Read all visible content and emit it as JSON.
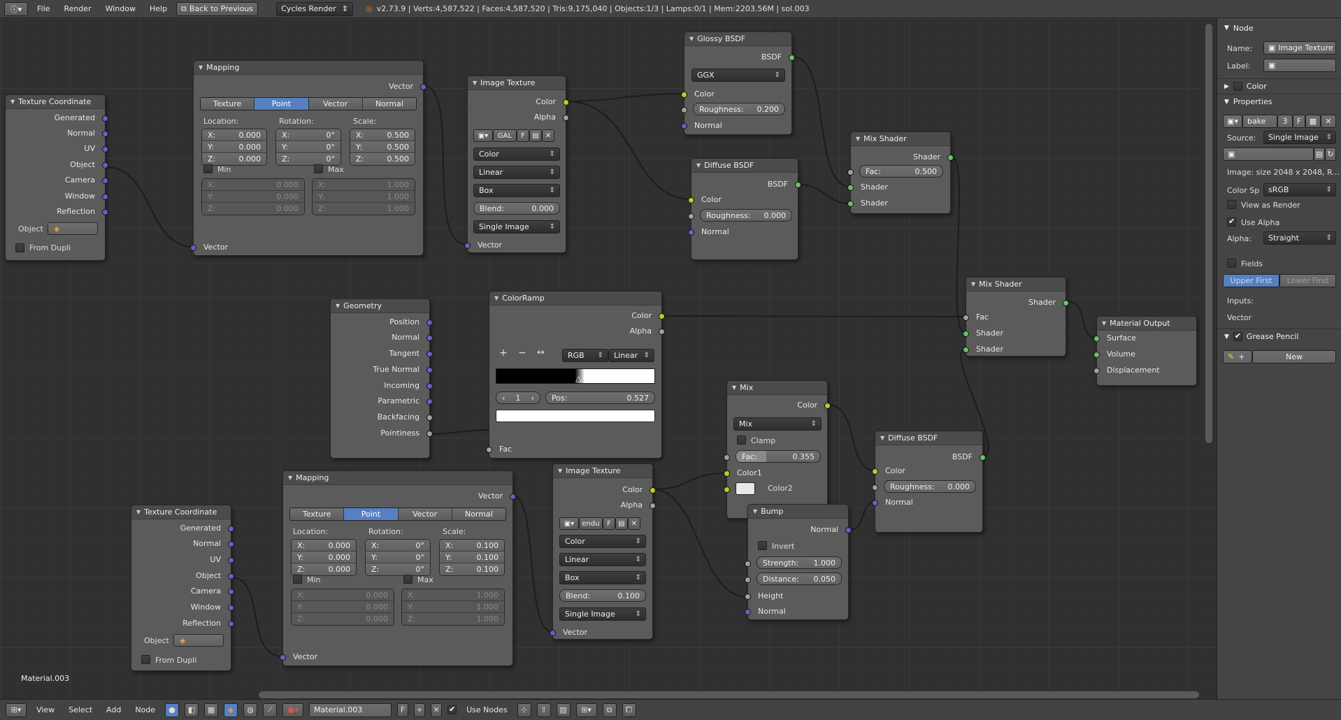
{
  "topbar": {
    "menus": [
      "File",
      "Render",
      "Window",
      "Help"
    ],
    "back_button": "Back to Previous",
    "engine": "Cycles Render",
    "stats": "v2.73.9 | Verts:4,587,522 | Faces:4,587,520 | Tris:9,175,040 | Objects:1/3 | Lamps:0/1 | Mem:2203.56M | sol.003"
  },
  "nodes": {
    "texcoord1": {
      "title": "Texture Coordinate",
      "outputs": [
        "Generated",
        "Normal",
        "UV",
        "Object",
        "Camera",
        "Window",
        "Reflection"
      ],
      "object_label": "Object",
      "from_dupli": "From Dupli"
    },
    "texcoord2": {
      "title": "Texture Coordinate",
      "outputs": [
        "Generated",
        "Normal",
        "UV",
        "Object",
        "Camera",
        "Window",
        "Reflection"
      ],
      "object_label": "Object",
      "from_dupli": "From Dupli"
    },
    "mapping1": {
      "title": "Mapping",
      "output": "Vector",
      "tabs": [
        "Texture",
        "Point",
        "Vector",
        "Normal"
      ],
      "active_tab": "Point",
      "location_label": "Location:",
      "rotation_label": "Rotation:",
      "scale_label": "Scale:",
      "location": [
        [
          "X:",
          "0.000"
        ],
        [
          "Y:",
          "0.000"
        ],
        [
          "Z:",
          "0.000"
        ]
      ],
      "rotation": [
        [
          "X:",
          "0°"
        ],
        [
          "Y:",
          "0°"
        ],
        [
          "Z:",
          "0°"
        ]
      ],
      "scale": [
        [
          "X:",
          "0.500"
        ],
        [
          "Y:",
          "0.500"
        ],
        [
          "Z:",
          "0.500"
        ]
      ],
      "min_label": "Min",
      "max_label": "Max",
      "min": [
        [
          "X:",
          "0.000"
        ],
        [
          "Y:",
          "0.000"
        ],
        [
          "Z:",
          "0.000"
        ]
      ],
      "max": [
        [
          "X:",
          "1.000"
        ],
        [
          "Y:",
          "1.000"
        ],
        [
          "Z:",
          "1.000"
        ]
      ],
      "input": "Vector"
    },
    "mapping2": {
      "title": "Mapping",
      "output": "Vector",
      "tabs": [
        "Texture",
        "Point",
        "Vector",
        "Normal"
      ],
      "active_tab": "Point",
      "location_label": "Location:",
      "rotation_label": "Rotation:",
      "scale_label": "Scale:",
      "location": [
        [
          "X:",
          "0.000"
        ],
        [
          "Y:",
          "0.000"
        ],
        [
          "Z:",
          "0.000"
        ]
      ],
      "rotation": [
        [
          "X:",
          "0°"
        ],
        [
          "Y:",
          "0°"
        ],
        [
          "Z:",
          "0°"
        ]
      ],
      "scale": [
        [
          "X:",
          "0.100"
        ],
        [
          "Y:",
          "0.100"
        ],
        [
          "Z:",
          "0.100"
        ]
      ],
      "min_label": "Min",
      "max_label": "Max",
      "min": [
        [
          "X:",
          "0.000"
        ],
        [
          "Y:",
          "0.000"
        ],
        [
          "Z:",
          "0.000"
        ]
      ],
      "max": [
        [
          "X:",
          "1.000"
        ],
        [
          "Y:",
          "1.000"
        ],
        [
          "Z:",
          "1.000"
        ]
      ],
      "input": "Vector"
    },
    "imgtex1": {
      "title": "Image Texture",
      "outputs": [
        "Color",
        "Alpha"
      ],
      "image_name": "GAL",
      "fake": "F",
      "color": "Color",
      "interp": "Linear",
      "proj": "Box",
      "blend_label": "Blend:",
      "blend": "0.000",
      "source": "Single Image",
      "input": "Vector"
    },
    "imgtex2": {
      "title": "Image Texture",
      "outputs": [
        "Color",
        "Alpha"
      ],
      "image_name": "endu",
      "fake": "F",
      "color": "Color",
      "interp": "Linear",
      "proj": "Box",
      "blend_label": "Blend:",
      "blend": "0.100",
      "source": "Single Image",
      "input": "Vector"
    },
    "glossy": {
      "title": "Glossy BSDF",
      "output": "BSDF",
      "distribution": "GGX",
      "color": "Color",
      "roughness_label": "Roughness:",
      "roughness": "0.200",
      "normal": "Normal"
    },
    "diffuse1": {
      "title": "Diffuse BSDF",
      "output": "BSDF",
      "color": "Color",
      "roughness_label": "Roughness:",
      "roughness": "0.000",
      "normal": "Normal"
    },
    "diffuse2": {
      "title": "Diffuse BSDF",
      "output": "BSDF",
      "color": "Color",
      "roughness_label": "Roughness:",
      "roughness": "0.000",
      "normal": "Normal"
    },
    "mixshader1": {
      "title": "Mix Shader",
      "output": "Shader",
      "fac_label": "Fac:",
      "fac": "0.500",
      "inputs": [
        "Shader",
        "Shader"
      ]
    },
    "mixshader2": {
      "title": "Mix Shader",
      "output": "Shader",
      "inputs": [
        "Fac",
        "Shader",
        "Shader"
      ]
    },
    "geometry": {
      "title": "Geometry",
      "outputs": [
        "Position",
        "Normal",
        "Tangent",
        "True Normal",
        "Incoming",
        "Parametric",
        "Backfacing",
        "Pointiness"
      ]
    },
    "colorramp": {
      "title": "ColorRamp",
      "outputs": [
        "Color",
        "Alpha"
      ],
      "mode": "RGB",
      "interp": "Linear",
      "index": "1",
      "pos_label": "Pos:",
      "pos": "0.527",
      "input": "Fac",
      "ramp_stop": 0.527,
      "ramp_left": "#000000",
      "ramp_right": "#ffffff"
    },
    "mix": {
      "title": "Mix",
      "output": "Color",
      "blend": "Mix",
      "clamp": "Clamp",
      "fac_label": "Fac:",
      "fac": "0.355",
      "fac_fill": 0.355,
      "inputs": [
        "Color1",
        "Color2"
      ]
    },
    "bump": {
      "title": "Bump",
      "output": "Normal",
      "invert": "Invert",
      "strength_label": "Strength:",
      "strength": "1.000",
      "distance_label": "Distance:",
      "distance": "0.050",
      "inputs": [
        "Height",
        "Normal"
      ]
    },
    "output": {
      "title": "Material Output",
      "inputs": [
        "Surface",
        "Volume",
        "Displacement"
      ]
    }
  },
  "material_label": "Material.003",
  "sidebar": {
    "node_header": "Node",
    "name_label": "Name:",
    "name_value": "Image Texture",
    "label_label": "Label:",
    "label_value": "",
    "color_header": "Color",
    "properties_header": "Properties",
    "image_name": "bake",
    "image_users": "3",
    "image_fake": "F",
    "source_label": "Source:",
    "source_value": "Single Image",
    "image_info": "Image: size 2048 x 2048, R...",
    "colorspace_label": "Color Sp",
    "colorspace_value": "sRGB",
    "view_as_render": "View as Render",
    "use_alpha": "Use Alpha",
    "alpha_label": "Alpha:",
    "alpha_value": "Straight",
    "fields": "Fields",
    "upper_first": "Upper First",
    "lower_first": "Lower First",
    "inputs_label": "Inputs:",
    "vector_label": "Vector",
    "grease_header": "Grease Pencil",
    "new_button": "New"
  },
  "bottombar": {
    "menus": [
      "View",
      "Select",
      "Add",
      "Node"
    ],
    "material": "Material.003",
    "fake": "F",
    "use_nodes": "Use Nodes"
  },
  "colors": {
    "vector_socket": "#6363c7",
    "color_socket": "#c7c729",
    "float_socket": "#a1a1a1",
    "shader_socket": "#63c763",
    "accent": "#5680c2"
  }
}
